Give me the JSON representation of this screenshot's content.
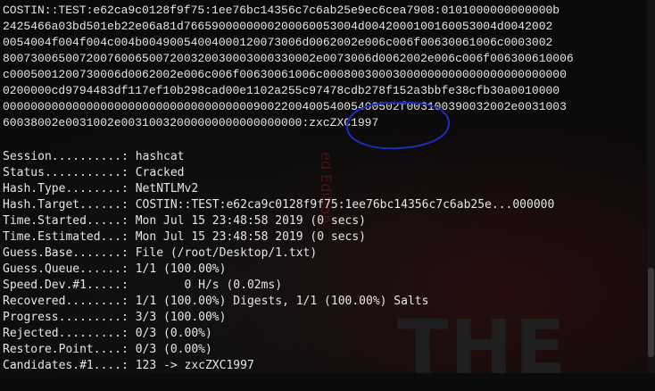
{
  "hash_output": {
    "lines": [
      "COSTIN::TEST:e62ca9c0128f9f75:1ee76bc14356c7c6ab25e9ec6cea7908:0101000000000000b",
      "2425466a03bd501eb22e06a81d7665900000000200060053004d0042000100160053004d0042002",
      "0054004f004f004c004b00490054004000120073006d0062002e006c006f00630061006c0003002",
      "800730065007200760065007200320030003000330002e0073006d0062002e006c006f006300610006",
      "c0005001200730006d0062002e006c006f00630061006c00080030003000000000000000000000000",
      "0200000cd9794483df117ef10b298cad00e1102a255c97478cdb278f152a3bbfe38cfb30a0010000",
      "000000000000000000000000000000000000900220040054005400502f003100390032002e0031003",
      "60038002e0031002e00310032000000000000000000:zxcZXC1997"
    ]
  },
  "session_info": [
    {
      "label": "Session..........:",
      "value": "hashcat"
    },
    {
      "label": "Status...........:",
      "value": "Cracked"
    },
    {
      "label": "Hash.Type........:",
      "value": "NetNTLMv2"
    },
    {
      "label": "Hash.Target......:",
      "value": "COSTIN::TEST:e62ca9c0128f9f75:1ee76bc14356c7c6ab25e...000000"
    },
    {
      "label": "Time.Started.....:",
      "value": "Mon Jul 15 23:48:58 2019 (0 secs)"
    },
    {
      "label": "Time.Estimated...:",
      "value": "Mon Jul 15 23:48:58 2019 (0 secs)"
    },
    {
      "label": "Guess.Base.......:",
      "value": "File (/root/Desktop/1.txt)"
    },
    {
      "label": "Guess.Queue......:",
      "value": "1/1 (100.00%)"
    },
    {
      "label": "Speed.Dev.#1.....:",
      "value": "       0 H/s (0.02ms)"
    },
    {
      "label": "Recovered........:",
      "value": "1/1 (100.00%) Digests, 1/1 (100.00%) Salts"
    },
    {
      "label": "Progress.........:",
      "value": "3/3 (100.00%)"
    },
    {
      "label": "Rejected.........:",
      "value": "0/3 (0.00%)"
    },
    {
      "label": "Restore.Point....:",
      "value": "0/3 (0.00%)"
    },
    {
      "label": "Candidates.#1....:",
      "value": "123 -> zxcZXC1997"
    }
  ],
  "watermark": {
    "text": "THE",
    "side_text": "ed Edition"
  },
  "colors": {
    "text": "#e6e6e6",
    "background": "#0a0a0a",
    "annotation": "#1a2fb8"
  }
}
